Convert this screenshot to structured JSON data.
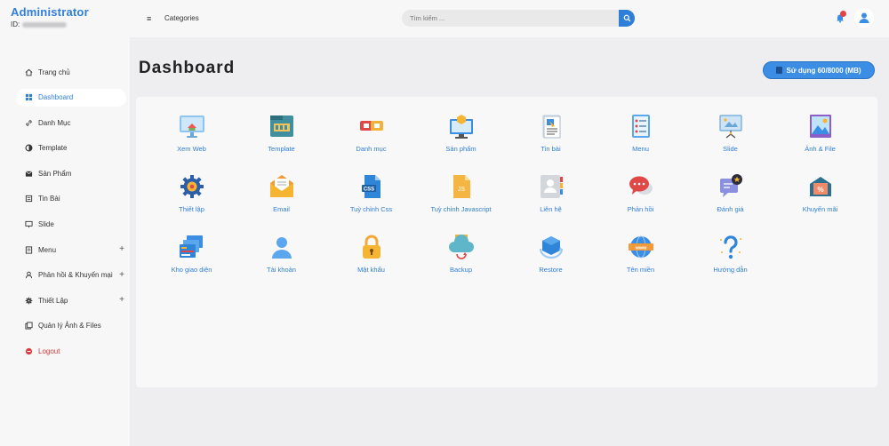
{
  "brand": {
    "title": "Administrator",
    "id_label": "ID:"
  },
  "sidebar": {
    "items": [
      {
        "label": "Trang chủ",
        "icon": "home-icon"
      },
      {
        "label": "Dashboard",
        "icon": "dashboard-icon",
        "active": true
      },
      {
        "label": "Danh Mục",
        "icon": "link-icon"
      },
      {
        "label": "Template",
        "icon": "palette-icon"
      },
      {
        "label": "Sản Phẩm",
        "icon": "box-icon"
      },
      {
        "label": "Tin Bài",
        "icon": "news-icon"
      },
      {
        "label": "Slide",
        "icon": "slide-icon"
      },
      {
        "label": "Menu",
        "icon": "menu-icon",
        "plus": "+"
      },
      {
        "label": "Phản hồi & Khuyến mại",
        "icon": "user-icon",
        "plus": "+"
      },
      {
        "label": "Thiết Lập",
        "icon": "gear-icon",
        "plus": "+"
      },
      {
        "label": "Quản lý Ảnh & Files",
        "icon": "files-icon"
      },
      {
        "label": "Logout",
        "icon": "logout-icon"
      }
    ]
  },
  "topbar": {
    "menu_glyph": "≡",
    "categories": "Categories",
    "search_placeholder": "Tìm kiếm ..."
  },
  "main": {
    "title": "Dashboard",
    "storage_label": "Sử dụng 60/8000 (MB)"
  },
  "tiles": [
    {
      "label": "Xem Web",
      "icon": "web-icon"
    },
    {
      "label": "Template",
      "icon": "template-icon"
    },
    {
      "label": "Danh mục",
      "icon": "category-icon"
    },
    {
      "label": "Sản phẩm",
      "icon": "product-icon"
    },
    {
      "label": "Tin bài",
      "icon": "news-icon"
    },
    {
      "label": "Menu",
      "icon": "menu-list-icon"
    },
    {
      "label": "Slide",
      "icon": "slide-icon"
    },
    {
      "label": "Ảnh & File",
      "icon": "image-icon"
    },
    {
      "label": "Thiết lập",
      "icon": "settings-icon"
    },
    {
      "label": "Email",
      "icon": "email-icon"
    },
    {
      "label": "Tuỳ chỉnh Css",
      "icon": "css-icon"
    },
    {
      "label": "Tuỳ chỉnh Javascript",
      "icon": "js-icon"
    },
    {
      "label": "Liên hệ",
      "icon": "contact-icon"
    },
    {
      "label": "Phản hồi",
      "icon": "feedback-icon"
    },
    {
      "label": "Đánh giá",
      "icon": "review-icon"
    },
    {
      "label": "Khuyến mãi",
      "icon": "promo-icon"
    },
    {
      "label": "Kho giao diện",
      "icon": "themes-icon"
    },
    {
      "label": "Tài khoản",
      "icon": "account-icon"
    },
    {
      "label": "Mật khẩu",
      "icon": "lock-icon"
    },
    {
      "label": "Backup",
      "icon": "backup-icon"
    },
    {
      "label": "Restore",
      "icon": "restore-icon"
    },
    {
      "label": "Tên miền",
      "icon": "domain-icon"
    },
    {
      "label": "Hướng dẫn",
      "icon": "help-icon"
    }
  ],
  "colors": {
    "accent": "#2f7fd8",
    "logout": "#d63a3a",
    "notification": "#e24343"
  }
}
